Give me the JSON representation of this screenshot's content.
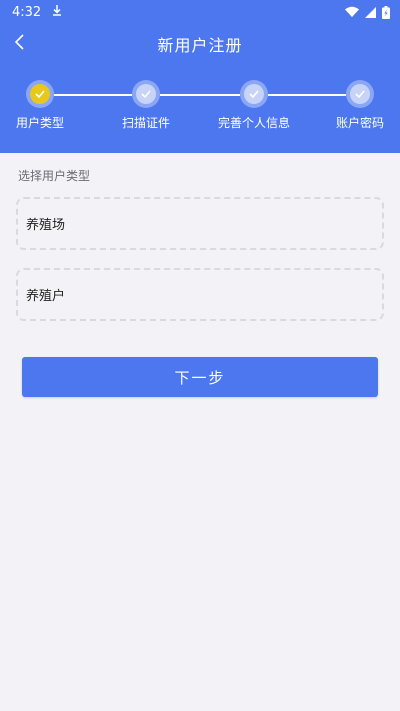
{
  "status_bar": {
    "time": "4:32"
  },
  "navbar": {
    "title": "新用户注册"
  },
  "stepper": {
    "steps": [
      {
        "label": "用户类型",
        "state": "active"
      },
      {
        "label": "扫描证件",
        "state": "inactive"
      },
      {
        "label": "完善个人信息",
        "state": "inactive"
      },
      {
        "label": "账户密码",
        "state": "inactive"
      }
    ]
  },
  "form": {
    "section_label": "选择用户类型",
    "options": [
      {
        "label": "养殖场"
      },
      {
        "label": "养殖户"
      }
    ],
    "next_label": "下一步"
  },
  "colors": {
    "primary": "#4d77ef",
    "active_step": "#e9c81c",
    "background": "#f2f2f7"
  }
}
